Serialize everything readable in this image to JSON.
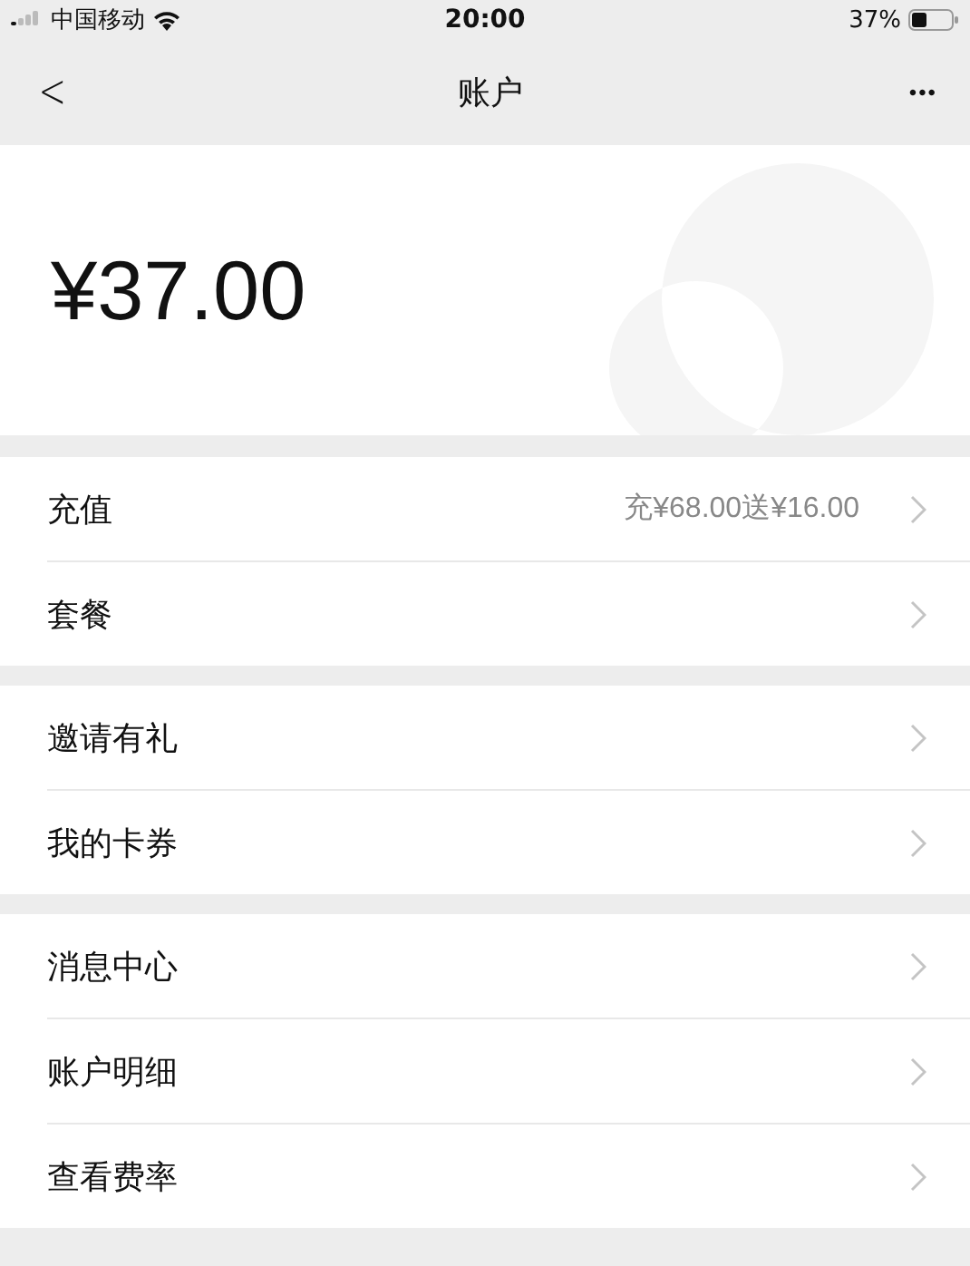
{
  "status_bar": {
    "carrier": "中国移动",
    "time": "20:00",
    "battery": "37%"
  },
  "nav": {
    "back": "<",
    "title": "账户",
    "more": "•••"
  },
  "balance": {
    "amount": "¥37.00"
  },
  "groups": [
    {
      "items": [
        {
          "label": "充值",
          "detail": "充¥68.00送¥16.00"
        },
        {
          "label": "套餐"
        }
      ]
    },
    {
      "items": [
        {
          "label": "邀请有礼"
        },
        {
          "label": "我的卡券"
        }
      ]
    },
    {
      "items": [
        {
          "label": "消息中心"
        },
        {
          "label": "账户明细"
        },
        {
          "label": "查看费率"
        }
      ]
    }
  ]
}
